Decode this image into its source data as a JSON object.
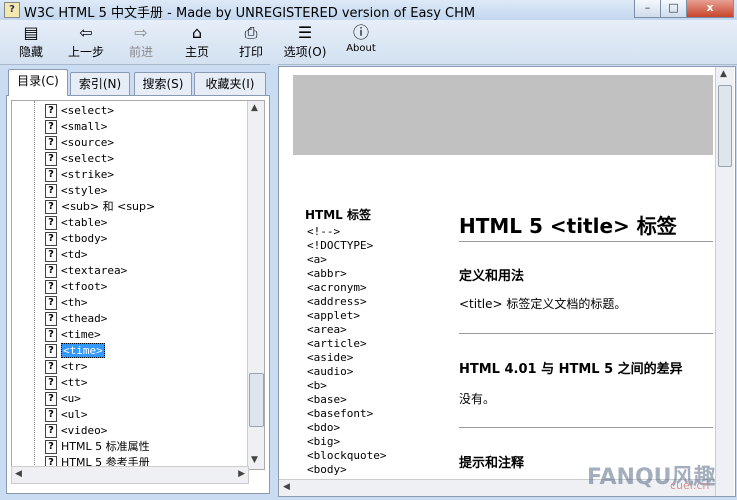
{
  "window": {
    "title": "W3C HTML 5 中文手册 - Made by UNREGISTERED version of Easy CHM",
    "app_icon": "help-question-icon",
    "controls": {
      "minimize": "–",
      "maximize": "□",
      "close": "x"
    }
  },
  "toolbar": {
    "buttons": [
      {
        "label": "隐藏",
        "icon": "hide-panel-icon",
        "glyph": "▤",
        "enabled": true
      },
      {
        "label": "上一步",
        "icon": "back-arrow-icon",
        "glyph": "⇦",
        "enabled": true
      },
      {
        "label": "前进",
        "icon": "forward-arrow-icon",
        "glyph": "⇨",
        "enabled": false
      },
      {
        "label": "主页",
        "icon": "home-icon",
        "glyph": "⌂",
        "enabled": true
      },
      {
        "label": "打印",
        "icon": "print-icon",
        "glyph": "⎙",
        "enabled": true
      },
      {
        "label": "选项(O)",
        "icon": "options-icon",
        "glyph": "☰",
        "enabled": true
      },
      {
        "label": "About",
        "icon": "about-icon",
        "glyph": "ⓘ",
        "enabled": true
      }
    ]
  },
  "nav_tabs": [
    {
      "label": "目录(C)",
      "active": true
    },
    {
      "label": "索引(N)",
      "active": false
    },
    {
      "label": "搜索(S)",
      "active": false
    },
    {
      "label": "收藏夹(I)",
      "active": false
    }
  ],
  "tree": {
    "item_icon_glyph": "?",
    "items": [
      "<select>",
      "<small>",
      "<source>",
      "<select>",
      "<strike>",
      "<style>",
      "<sub> 和 <sup>",
      "<table>",
      "<tbody>",
      "<td>",
      "<textarea>",
      "<tfoot>",
      "<th>",
      "<thead>",
      "<time>",
      "<time>",
      "<tr>",
      "<tt>",
      "<u>",
      "<ul>",
      "<video>",
      "HTML 5 标准属性",
      "HTML 5 参考手册"
    ],
    "selected_index": 15
  },
  "content": {
    "sidebar_title": "HTML 标签",
    "sidebar_tags": [
      "<!-->",
      "<!DOCTYPE>",
      "<a>",
      "<abbr>",
      "<acronym>",
      "<address>",
      "<applet>",
      "<area>",
      "<article>",
      "<aside>",
      "<audio>",
      "<b>",
      "<base>",
      "<basefont>",
      "<bdo>",
      "<big>",
      "<blockquote>",
      "<body>"
    ],
    "heading": "HTML 5 <title> 标签",
    "section1_title": "定义和用法",
    "section1_text": "<title> 标签定义文档的标题。",
    "section2_title": "HTML 4.01 与 HTML 5 之间的差异",
    "section2_text": "没有。",
    "section3_title": "提示和注释"
  },
  "watermark": {
    "text": "FANQU风趣",
    "sub": "cuel.cn"
  }
}
